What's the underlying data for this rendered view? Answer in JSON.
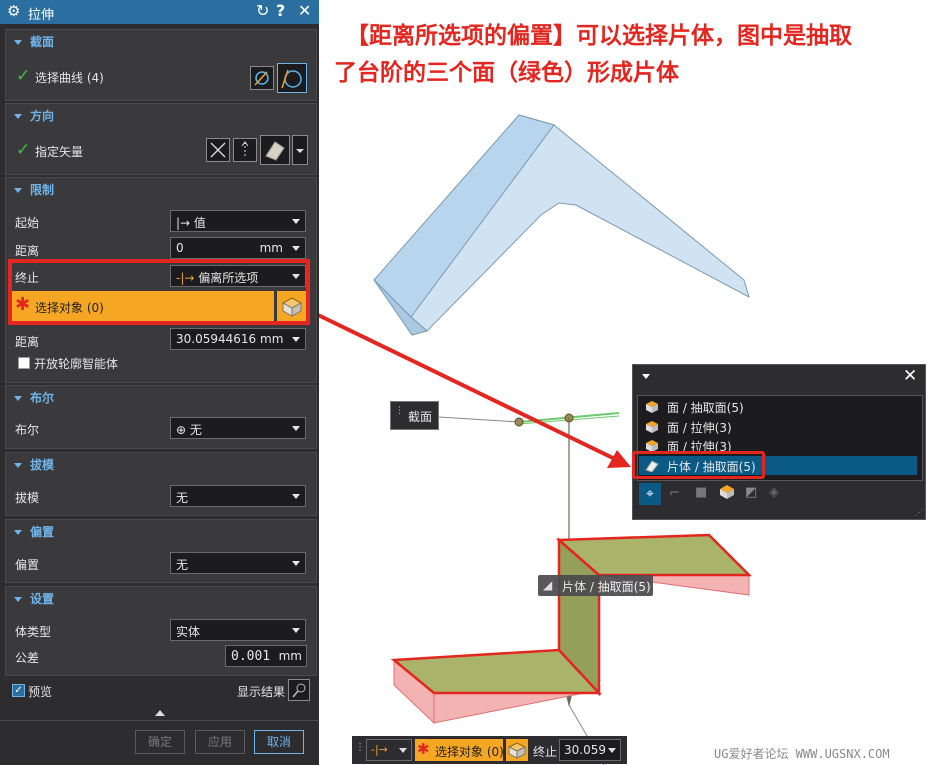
{
  "dialog": {
    "title": "拉伸",
    "title_icons": [
      "reset-icon",
      "help-icon",
      "close-icon"
    ],
    "section_label": {
      "header": "截面",
      "curve_label": "选择曲线 (4)"
    },
    "direction": {
      "header": "方向",
      "vector_label": "指定矢量"
    },
    "limits": {
      "header": "限制",
      "start_label": "起始",
      "start_value": "值",
      "start_dist_label": "距离",
      "start_dist_value": "0",
      "unit": "mm",
      "end_label": "终止",
      "end_value": "偏离所选项",
      "select_object": "选择对象 (0)",
      "end_dist_label": "距离",
      "end_dist_value": "30.05944616",
      "open_profile": "开放轮廓智能体"
    },
    "boolean": {
      "header": "布尔",
      "label": "布尔",
      "value": "无"
    },
    "draft": {
      "header": "拔模",
      "label": "拔模",
      "value": "无"
    },
    "offset": {
      "header": "偏置",
      "label": "偏置",
      "value": "无"
    },
    "settings": {
      "header": "设置",
      "body_type_label": "体类型",
      "body_type_value": "实体",
      "tolerance_label": "公差",
      "tolerance_value": "0.001",
      "tolerance_unit": "mm"
    },
    "preview": {
      "label": "预览",
      "show_result": "显示结果"
    },
    "buttons": {
      "ok": "确定",
      "apply": "应用",
      "cancel": "取消"
    }
  },
  "annotation": {
    "line1": "【距离所选项的偏置】可以选择片体，图中是抽取",
    "line2": "了台阶的三个面（绿色）形成片体",
    "color": "#e3261f"
  },
  "viewport": {
    "section_tag": "截面",
    "sheet_tag": "片体 / 抽取面(5)"
  },
  "popup": {
    "items": [
      "面 / 抽取面(5)",
      "面 / 拉伸(3)",
      "面 / 拉伸(3)",
      "片体 / 抽取面(5)"
    ],
    "selected_index": 3
  },
  "bottombar": {
    "select_object": "选择对象 (0)",
    "end_label": "终止",
    "end_value": "30.059"
  },
  "watermark": "UG爱好者论坛 WWW.UGSNX.COM",
  "colors": {
    "accent_blue": "#2b6fa0",
    "highlight_orange": "#f5a623",
    "selection_blue": "#0b5a86",
    "sheet_green": "#a9b46a",
    "part_blue": "#cfe3f2"
  }
}
